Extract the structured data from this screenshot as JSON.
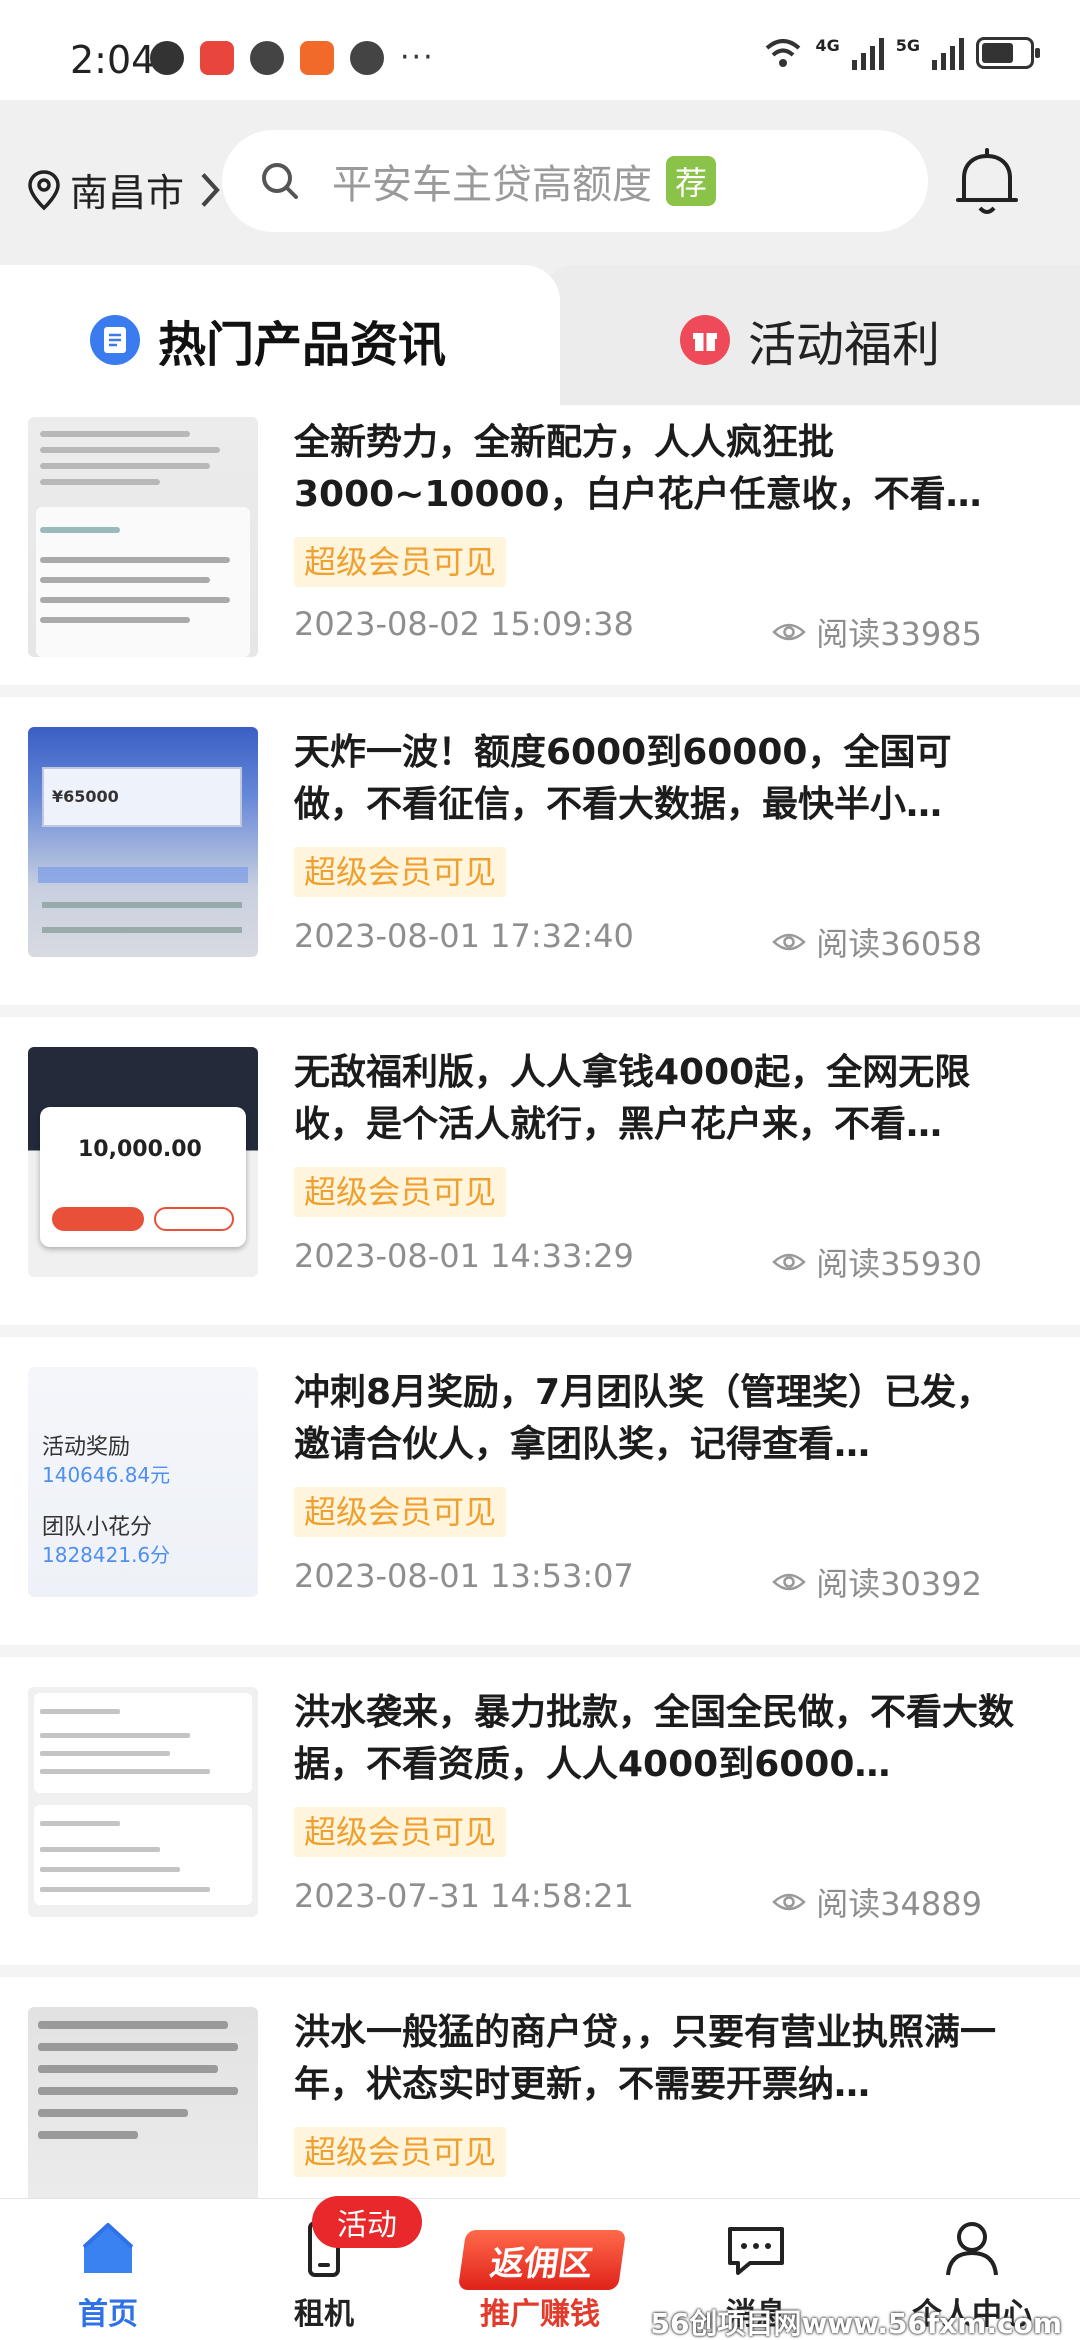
{
  "status_bar": {
    "time": "2:04",
    "dots": "···",
    "net1": "4G",
    "net2": "5G"
  },
  "header": {
    "city": "南昌市",
    "search_placeholder": "平安车主贷高额度",
    "search_tag": "荐"
  },
  "tabs": [
    {
      "label": "热门产品资讯",
      "active": true
    },
    {
      "label": "活动福利",
      "active": false
    }
  ],
  "articles": [
    {
      "title": "全新势力，全新配方，人人疯狂批3000~10000，白户花户任意收，不看…",
      "badge": "超级会员可见",
      "date": "2023-08-02 15:09:38",
      "reads": "阅读33985"
    },
    {
      "title": "天炸一波！额度6000到60000，全国可做，不看征信，不看大数据，最快半小…",
      "badge": "超级会员可见",
      "date": "2023-08-01 17:32:40",
      "reads": "阅读36058",
      "thumb_amount": "¥65000"
    },
    {
      "title": "无敌福利版，人人拿钱4000起，全网无限收，是个活人就行，黑户花户来，不看…",
      "badge": "超级会员可见",
      "date": "2023-08-01 14:33:29",
      "reads": "阅读35930",
      "thumb_amount": "10,000.00"
    },
    {
      "title": "冲刺8月奖励，7月团队奖（管理奖）已发，邀请合伙人，拿团队奖，记得查看…",
      "badge": "超级会员可见",
      "date": "2023-08-01 13:53:07",
      "reads": "阅读30392",
      "thumb_label1": "活动奖励",
      "thumb_value1": "140646.84元",
      "thumb_label2": "团队小花分",
      "thumb_value2": "1828421.6分"
    },
    {
      "title": "洪水袭来，暴力批款，全国全民做，不看大数据，不看资质，人人4000到6000…",
      "badge": "超级会员可见",
      "date": "2023-07-31 14:58:21",
      "reads": "阅读34889"
    },
    {
      "title": "洪水一般猛的商户贷，，只要有营业执照满一年，状态实时更新，不需要开票纳…",
      "badge": "超级会员可见"
    }
  ],
  "bottom_nav": {
    "home": "首页",
    "rent": "租机",
    "rent_badge": "活动",
    "promo": "推广赚钱",
    "promo_badge": "返佣区",
    "messages": "消息",
    "profile": "个人中心"
  },
  "watermark": "56创项目网www.56fxm.com",
  "colors": {
    "accent_blue": "#2f72e8",
    "vip_text": "#f0a030",
    "vip_bg": "#fff4dc",
    "red": "#e8282a"
  },
  "icons": [
    "location-pin-icon",
    "search-icon",
    "bell-icon",
    "document-icon",
    "gift-icon",
    "eye-icon",
    "home-icon",
    "phone-icon",
    "chat-icon",
    "person-icon"
  ]
}
